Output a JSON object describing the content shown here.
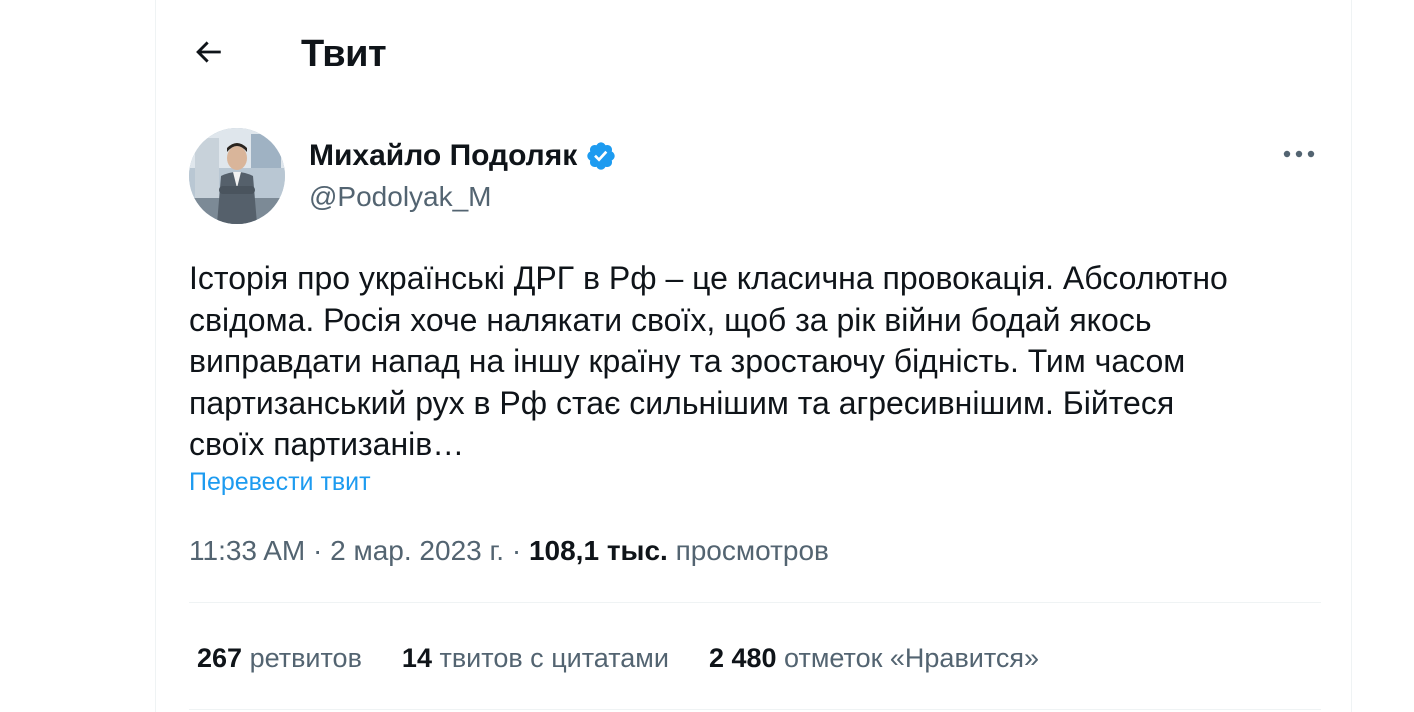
{
  "header": {
    "title": "Твит",
    "back_icon": "arrow-left-icon"
  },
  "author": {
    "name": "Михайло Подоляк",
    "handle": "@Podolyak_M",
    "verified": true,
    "verified_color": "#1d9bf0"
  },
  "tweet": {
    "text": "Історія про українські ДРГ в Рф – це класична провокація. Абсолютно\nсвідома. Росія хоче налякати своїх, щоб за рік війни бодай якось\nвиправдати напад на іншу країну та зростаючу бідність. Тим часом\nпартизанський рух в Рф стає сильнішим та агресивнішим. Бійтеся\nсвоїх партизанів…",
    "translate_label": "Перевести твит"
  },
  "meta": {
    "time": "11:33 AM",
    "separator": " · ",
    "date": "2 мар. 2023 г.",
    "views_count": "108,1 тыс.",
    "views_label": " просмотров"
  },
  "stats": {
    "retweets_count": "267",
    "retweets_label": " ретвитов",
    "quotes_count": "14",
    "quotes_label": " твитов с цитатами",
    "likes_count": "2 480",
    "likes_label": " отметок «Нравится»"
  },
  "colors": {
    "link": "#1d9bf0",
    "secondary_text": "#536471",
    "primary_text": "#0f1419"
  }
}
